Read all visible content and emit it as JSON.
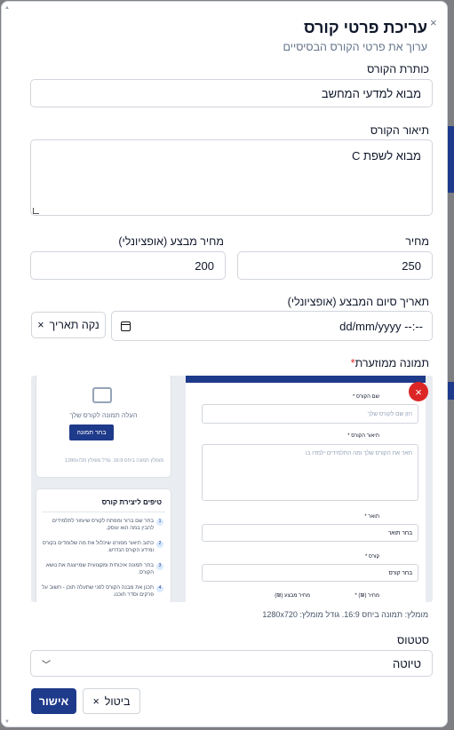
{
  "modal": {
    "close_glyph": "×",
    "title": "עריכת פרטי קורס",
    "subtitle": "ערוך את פרטי הקורס הבסיסיים"
  },
  "course_title": {
    "label": "כותרת הקורס",
    "value": "מבוא למדעי המחשב"
  },
  "course_description": {
    "label": "תיאור הקורס",
    "value": "מבוא לשפת C"
  },
  "price": {
    "label": "מחיר",
    "value": "250"
  },
  "sale_price": {
    "label": "מחיר מבצע (אופציונלי)",
    "value": "200"
  },
  "sale_end": {
    "label": "תאריך סיום המבצע (אופציונלי)",
    "value": "dd/mm/yyyy --:--",
    "clear_label": "נקה תאריך",
    "clear_glyph": "×"
  },
  "featured_image": {
    "label": "תמונה ממוזערת",
    "required_mark": "*",
    "hint": "מומלץ: תמונה ביחס 16:9. גודל מומלץ: 1280x720",
    "preview": {
      "upload_text": "העלה תמונה לקורס שלך",
      "upload_button": "בחר תמונה",
      "upload_hint": "מומלץ תמונה ביחס 16:9. גודל מומלץ 1280x720",
      "tips_title": "טיפים ליצירת קורס",
      "tips": [
        {
          "num": "1",
          "text": "בחר שם ברור ומפתח לקורס שיעזור לתלמידים להבין במה הוא עוסק."
        },
        {
          "num": "2",
          "text": "כתוב תיאור מפורט שיכלול את מה שלומדים בקורס ומידע הקורס הנדרש."
        },
        {
          "num": "3",
          "text": "בחר תמונה איכותית ומקצועית שמייצגת את נושא הקורס."
        },
        {
          "num": "4",
          "text": "תכנן את מבנה הקורס לפני שתעלה תוכן - חשוב על פרקים וסדר תוכנו."
        }
      ],
      "form_labels": {
        "name": "שם הקורס *",
        "description": "תיאור הקורס *",
        "degree": "תואר *",
        "course": "קורס *",
        "price": "מחיר (₪) *",
        "sale": "מחיר מבצע (₪)"
      },
      "form_placeholders": {
        "name": "הזן שם לקורס שלך",
        "description": "תאר את הקורס שלך ומה התלמידים ילמדו בו",
        "degree": "בחר תואר",
        "course": "בחר קורס"
      },
      "remove_glyph": "×"
    }
  },
  "status": {
    "label": "סטטוס",
    "value": "טיוטה"
  },
  "actions": {
    "confirm": "אישור",
    "cancel": "ביטול",
    "cancel_glyph": "×"
  },
  "colors": {
    "primary": "#1e3a8a",
    "danger": "#dc2626",
    "border": "#d1d5db"
  }
}
